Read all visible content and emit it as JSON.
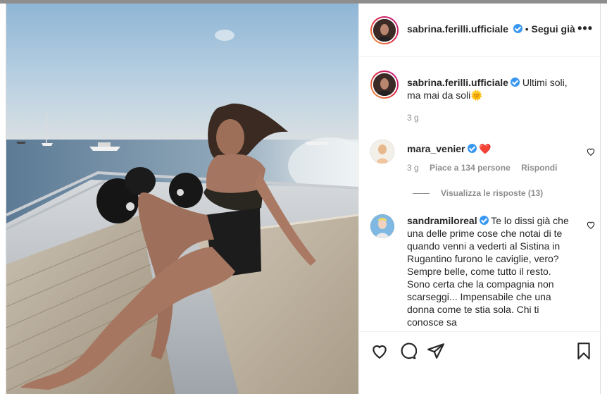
{
  "post": {
    "username": "sabrina.ferilli.ufficiale",
    "follow_separator": "•",
    "follow_label": "Segui già",
    "more_label": "•••"
  },
  "caption": {
    "username": "sabrina.ferilli.ufficiale",
    "text": "Ultimi soli, ma mai da soli🌞",
    "time": "3 g"
  },
  "comments": [
    {
      "username": "mara_venier",
      "text": "❤️",
      "time": "3 g",
      "likes": "Piace a 134 persone",
      "reply": "Rispondi",
      "view_replies": "Visualizza le risposte (13)"
    },
    {
      "username": "sandramiloreal",
      "text": "Te lo dissi già che una delle prime cose che notai di te quando venni a vederti al Sistina in Rugantino furono le caviglie, vero? Sempre belle, come tutto il resto. Sono certa che la compagnia non scarseggi... Impensabile che una donna come te stia sola. Chi ti conosce sa"
    }
  ],
  "icons": {
    "like": "heart-icon",
    "comment": "comment-icon",
    "share": "share-icon",
    "save": "bookmark-icon"
  },
  "colors": {
    "verified": "#3897f0",
    "text": "#262626",
    "muted": "#8e8e8e",
    "border": "#dbdbdb"
  }
}
